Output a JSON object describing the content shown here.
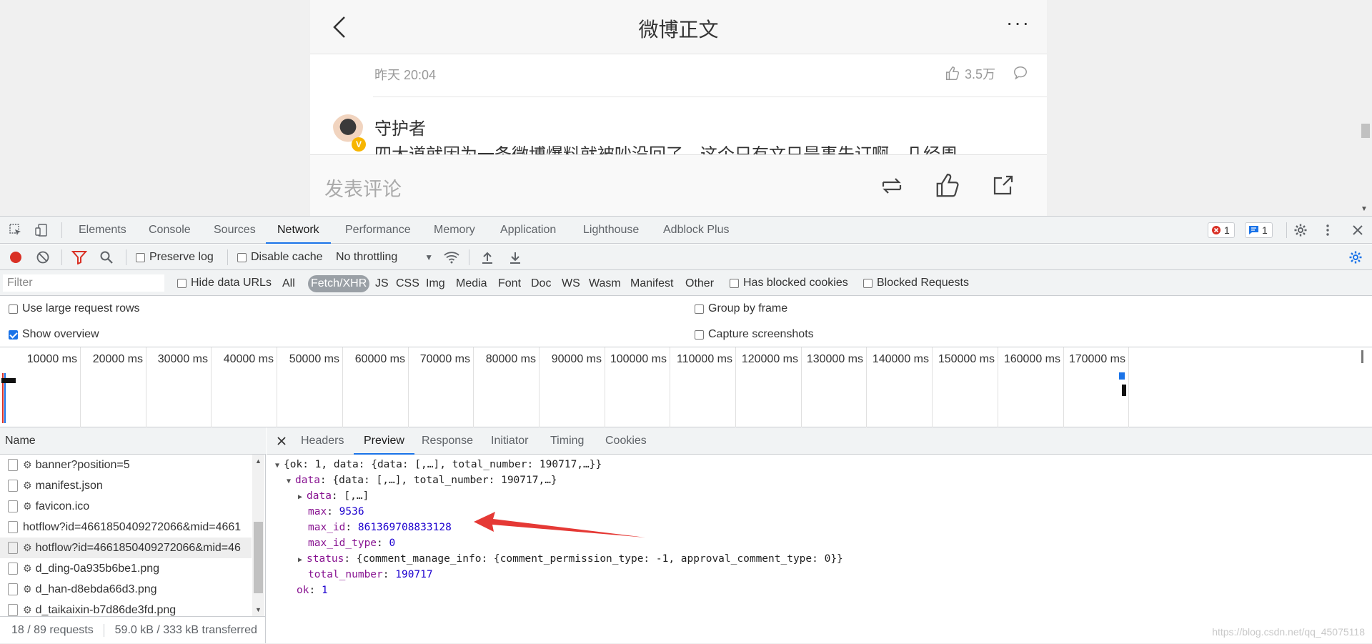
{
  "page": {
    "title": "微博正文",
    "comment_time": "昨天 20:04",
    "like_count": "3.5万",
    "commenter_name": "守护者",
    "comment_text": "四大道就因为一条微博爆料就被吵没回了，这个只有文只是事先订啊，几经周",
    "vip_badge": "V",
    "comment_placeholder": "发表评论",
    "more_glyph": "···"
  },
  "devtools": {
    "tabs": [
      "Elements",
      "Console",
      "Sources",
      "Network",
      "Performance",
      "Memory",
      "Application",
      "Lighthouse",
      "Adblock Plus"
    ],
    "active_tab": "Network",
    "error_count": "1",
    "message_count": "1",
    "toolbar": {
      "preserve_log": "Preserve log",
      "disable_cache": "Disable cache",
      "throttling": "No throttling"
    },
    "filter": {
      "placeholder": "Filter",
      "hide_data_urls": "Hide data URLs",
      "types": [
        "All",
        "Fetch/XHR",
        "JS",
        "CSS",
        "Img",
        "Media",
        "Font",
        "Doc",
        "WS",
        "Wasm",
        "Manifest",
        "Other"
      ],
      "active_type": "Fetch/XHR",
      "has_blocked_cookies": "Has blocked cookies",
      "blocked_requests": "Blocked Requests"
    },
    "options": {
      "large_rows": "Use large request rows",
      "show_overview": "Show overview",
      "group_by_frame": "Group by frame",
      "capture_screenshots": "Capture screenshots"
    },
    "overview_ticks": [
      "10000 ms",
      "20000 ms",
      "30000 ms",
      "40000 ms",
      "50000 ms",
      "60000 ms",
      "70000 ms",
      "80000 ms",
      "90000 ms",
      "100000 ms",
      "110000 ms",
      "120000 ms",
      "130000 ms",
      "140000 ms",
      "150000 ms",
      "160000 ms",
      "170000 ms"
    ],
    "requests": {
      "header": "Name",
      "rows": [
        {
          "name": "banner?position=5",
          "icon": true,
          "check": true
        },
        {
          "name": "manifest.json",
          "icon": true,
          "check": true
        },
        {
          "name": "favicon.ico",
          "icon": true,
          "check": true
        },
        {
          "name": "hotflow?id=4661850409272066&mid=4661",
          "icon": false,
          "check": true
        },
        {
          "name": "hotflow?id=4661850409272066&mid=46",
          "icon": true,
          "check": true,
          "selected": true
        },
        {
          "name": "d_ding-0a935b6be1.png",
          "icon": true,
          "check": true
        },
        {
          "name": "d_han-d8ebda66d3.png",
          "icon": true,
          "check": true
        },
        {
          "name": "d_taikaixin-b7d86de3fd.png",
          "icon": true,
          "check": true
        }
      ],
      "status_requests": "18 / 89 requests",
      "status_transferred": "59.0 kB / 333 kB transferred"
    },
    "detail_tabs": [
      "Headers",
      "Preview",
      "Response",
      "Initiator",
      "Timing",
      "Cookies"
    ],
    "active_detail_tab": "Preview",
    "preview": {
      "root": "{ok: 1, data: {data: [,…], total_number: 190717,…}}",
      "data_summary": "{data: [,…], total_number: 190717,…}",
      "data_data": "[,…]",
      "max": "9536",
      "max_id": "861369708833128",
      "max_id_type": "0",
      "status": "{comment_manage_info: {comment_permission_type: -1, approval_comment_type: 0}}",
      "total_number": "190717",
      "ok": "1",
      "keys": {
        "data": "data",
        "data_data": "data",
        "max": "max",
        "max_id": "max_id",
        "max_id_type": "max_id_type",
        "status": "status",
        "total_number": "total_number",
        "ok": "ok"
      }
    },
    "watermark": "https://blog.csdn.net/qq_45075118"
  },
  "colors": {
    "accent": "#1a73e8",
    "record": "#d93025",
    "arrow": "#e53935"
  }
}
